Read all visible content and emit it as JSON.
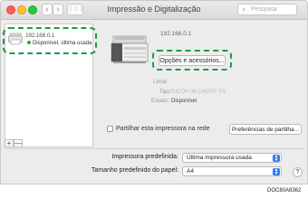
{
  "window": {
    "title": "Impressão e Digitalização",
    "search_placeholder": "Pesquisa",
    "nav": {
      "back": "‹",
      "forward": "›",
      "grid": "⋮⋮⋮"
    }
  },
  "printer_list": {
    "items": [
      {
        "name": "192.168.0.1",
        "status": "Disponível, última usada"
      }
    ],
    "add_label": "+",
    "remove_label": "—"
  },
  "detail": {
    "printer_name": "192.168.0.1",
    "options_button": "Opções e acessórios...",
    "location_label": "Local:",
    "location_value": "",
    "type_label": "Tipo:",
    "type_value": "RICOH IM C4500F PS",
    "status_label": "Estado:",
    "status_value": "Disponível"
  },
  "sharing": {
    "checkbox_label": "Partilhar esta impressora na rede",
    "prefs_button": "Preferências de partilha..."
  },
  "defaults": {
    "printer_label": "Impressora predefinida:",
    "printer_value": "Última impressora usada",
    "paper_label": "Tamanho predefinido do papel:",
    "paper_value": "A4"
  },
  "colors": {
    "highlight": "#1e9a48",
    "accent": "#2f7df4",
    "status_dot": "#2eaa2e"
  },
  "figure_code": "DOC80A8362"
}
